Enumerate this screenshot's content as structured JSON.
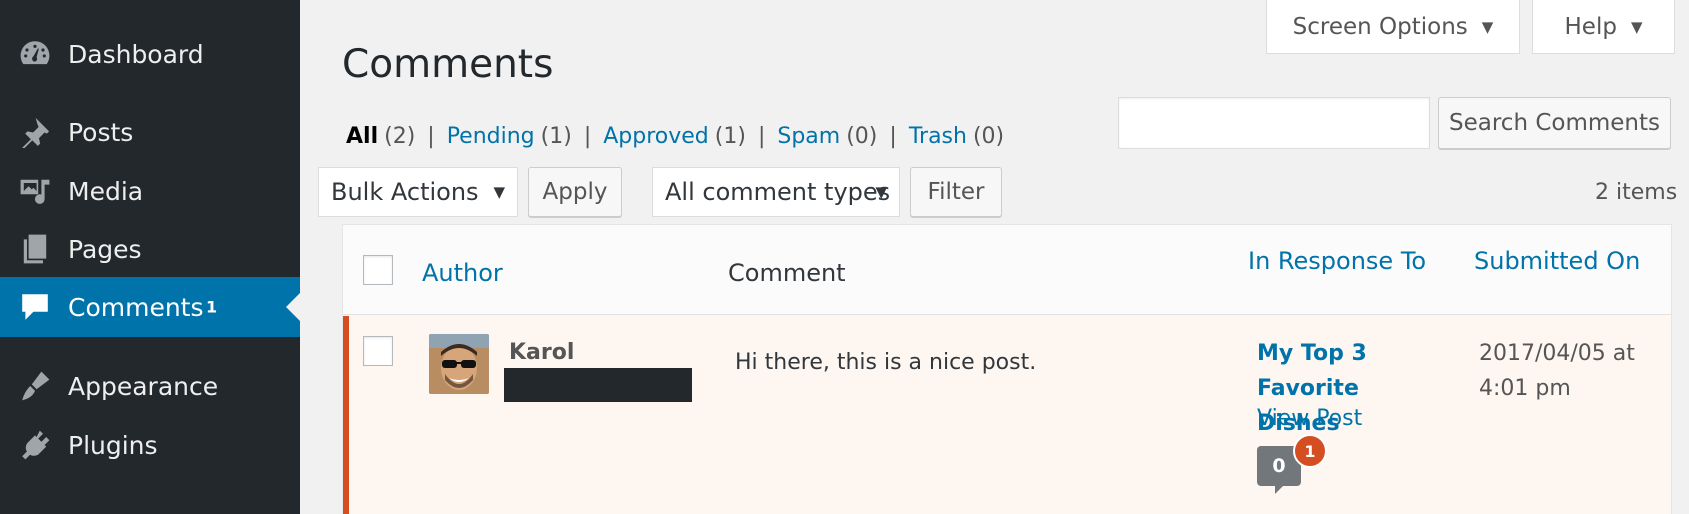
{
  "sidebar": {
    "items": [
      {
        "label": "Dashboard",
        "icon": "dashboard-icon"
      },
      {
        "label": "Posts",
        "icon": "pin-icon"
      },
      {
        "label": "Media",
        "icon": "media-icon"
      },
      {
        "label": "Pages",
        "icon": "pages-icon"
      },
      {
        "label": "Comments",
        "icon": "comment-icon",
        "badge": "1",
        "active": true
      },
      {
        "label": "Appearance",
        "icon": "paintbrush-icon"
      },
      {
        "label": "Plugins",
        "icon": "plug-icon"
      }
    ]
  },
  "header": {
    "screen_options": "Screen Options",
    "help": "Help",
    "title": "Comments"
  },
  "filters": {
    "all": "All",
    "all_count": "(2)",
    "pending": "Pending",
    "pending_count": "(1)",
    "approved": "Approved",
    "approved_count": "(1)",
    "spam": "Spam",
    "spam_count": "(0)",
    "trash": "Trash",
    "trash_count": "(0)",
    "separator": "|"
  },
  "search": {
    "value": "",
    "button": "Search Comments"
  },
  "toolbar": {
    "bulk_actions": "Bulk Actions",
    "apply": "Apply",
    "comment_types": "All comment types",
    "filter": "Filter",
    "items_count": "2 items"
  },
  "table": {
    "columns": [
      "Author",
      "Comment",
      "In Response To",
      "Submitted On"
    ],
    "rows": [
      {
        "author": "Karol",
        "comment": "Hi there, this is a nice post.",
        "post_title": "My Top 3 Favorite Dishes",
        "view_post": "View Post",
        "approved_count": "0",
        "pending_count": "1",
        "submitted": "2017/04/05 at 4:01 pm"
      }
    ]
  },
  "colors": {
    "sidebar_bg": "#23282d",
    "active_bg": "#0073aa",
    "link": "#0073aa",
    "pending_border": "#d54e21"
  }
}
